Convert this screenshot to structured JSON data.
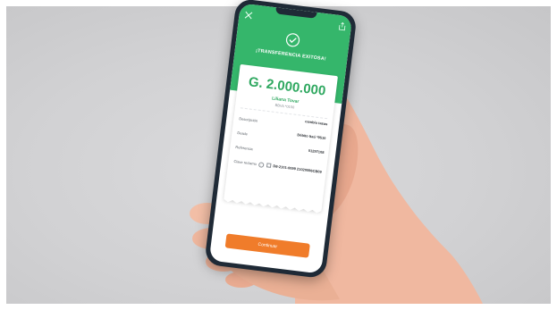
{
  "screen": {
    "title": "¡TRANSFERENCIA EXITOSA!",
    "icons": {
      "close": "close-icon",
      "share": "share-icon",
      "success": "check-circle-icon"
    }
  },
  "receipt": {
    "amount": "G. 2.000.000",
    "recipient_name": "Liliana Tovar",
    "recipient_bank": "BBVA *0150",
    "rows": [
      {
        "label": "Descripción",
        "value": "cambio tasas"
      },
      {
        "label": "Desde",
        "value": "Débito Itaú *9510"
      },
      {
        "label": "Referencia",
        "value": "01297108"
      },
      {
        "label": "Clave reclamo",
        "value": "D8-2101-0099 21020096CB09"
      }
    ]
  },
  "actions": {
    "primary_label": "Continuar"
  },
  "colors": {
    "header_green": "#35b66b",
    "amount_green": "#2fa860",
    "button_orange": "#f07c2a",
    "phone_frame": "#1f2a36",
    "background_gray": "#d1d1d3"
  }
}
